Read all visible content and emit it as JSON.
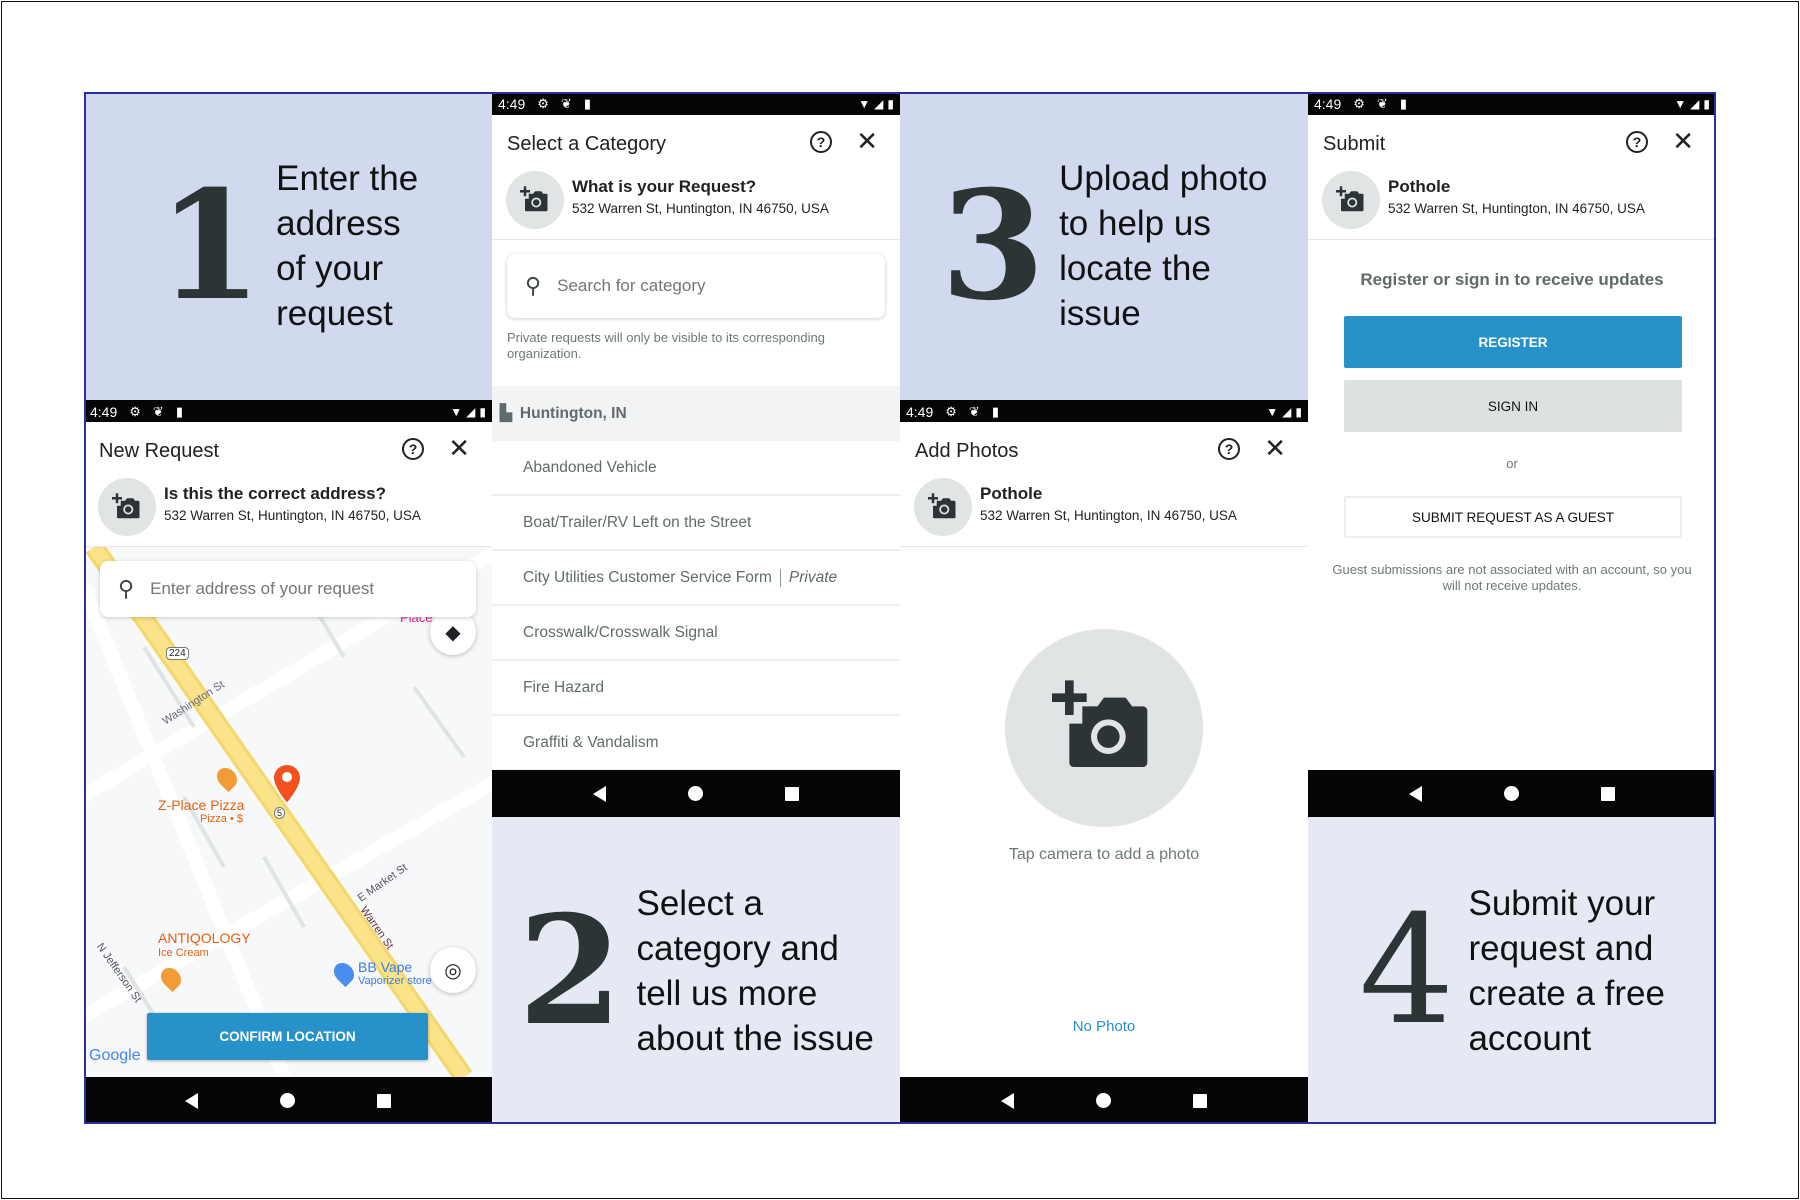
{
  "status_bar": {
    "time": "4:49"
  },
  "steps": [
    {
      "number": "1",
      "text": "Enter the\naddress\nof your\nrequest"
    },
    {
      "number": "2",
      "text": "Select a\ncategory and\ntell us more\nabout the issue"
    },
    {
      "number": "3",
      "text": "Upload photo\nto help us\nlocate the\nissue"
    },
    {
      "number": "4",
      "text": "Submit your\nrequest and\ncreate a free\naccount"
    }
  ],
  "screen1": {
    "title": "New Request",
    "info_title": "Is this the correct address?",
    "address": "532 Warren St, Huntington, IN 46750, USA",
    "search_placeholder": "Enter address of your request",
    "map_labels": {
      "place": "Place of Gr",
      "route": "224",
      "route2": "5",
      "washington": "Washington St",
      "zplace": "Z-Place Pizza",
      "zplace_sub": "Pizza • $",
      "antiqology": "ANTIQOLOGY",
      "antiqology_sub": "Ice Cream",
      "market": "E Market St",
      "warren": "Warren St",
      "jefferson": "N Jefferson St",
      "bbvape": "BB Vape",
      "bbvape_sub": "Vaporizer store",
      "google": "Google"
    },
    "confirm_label": "CONFIRM LOCATION"
  },
  "screen2": {
    "title": "Select a Category",
    "info_title": "What is your Request?",
    "address": "532 Warren St, Huntington, IN 46750, USA",
    "search_placeholder": "Search for category",
    "note": "Private requests will only be visible to its corresponding organization.",
    "section": "Huntington, IN",
    "categories": [
      {
        "label": "Abandoned Vehicle"
      },
      {
        "label": "Boat/Trailer/RV Left on the Street"
      },
      {
        "label": "City Utilities Customer Service Form",
        "tag": "Private"
      },
      {
        "label": "Crosswalk/Crosswalk Signal"
      },
      {
        "label": "Fire Hazard"
      },
      {
        "label": "Graffiti & Vandalism"
      }
    ]
  },
  "screen3": {
    "title": "Add Photos",
    "info_title": "Pothole",
    "address": "532 Warren St, Huntington, IN 46750, USA",
    "tap_text": "Tap camera to add a photo",
    "no_photo": "No Photo"
  },
  "screen4": {
    "title": "Submit",
    "info_title": "Pothole",
    "address": "532 Warren St, Huntington, IN 46750, USA",
    "prompt": "Register or sign in to receive updates",
    "register_label": "REGISTER",
    "signin_label": "SIGN IN",
    "or": "or",
    "guest_label": "SUBMIT REQUEST AS A GUEST",
    "guest_note": "Guest submissions are not associated with an account, so you will not receive updates."
  },
  "colors": {
    "accent": "#2791c9",
    "promo_dark": "#d0d9ee",
    "promo_light": "#e4e9f4",
    "pin": "#f4511e"
  },
  "icons": [
    "help-icon",
    "close-icon",
    "add-camera-icon",
    "search-icon",
    "layers-icon",
    "my-location-icon",
    "city-icon"
  ]
}
